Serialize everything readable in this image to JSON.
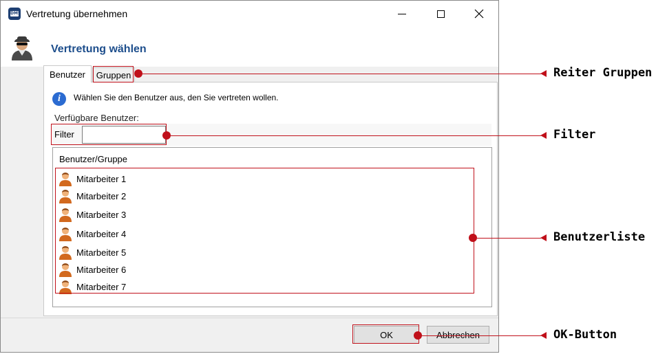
{
  "window": {
    "title": "Vertretung übernehmen",
    "app_icon_text": "DMS",
    "heading": "Vertretung wählen"
  },
  "tabs": [
    {
      "label": "Benutzer",
      "active": true
    },
    {
      "label": "Gruppen",
      "active": false
    }
  ],
  "panel": {
    "info_text": "Wählen Sie den Benutzer aus, den Sie vertreten wollen.",
    "available_label": "Verfügbare Benutzer:",
    "filter_label": "Filter",
    "filter_value": "",
    "list_header": "Benutzer/Gruppe",
    "users": [
      "Mitarbeiter 1",
      "Mitarbeiter 2",
      "Mitarbeiter 3",
      "Mitarbeiter 4",
      "Mitarbeiter 5",
      "Mitarbeiter 6",
      "Mitarbeiter 7"
    ]
  },
  "buttons": {
    "ok": "OK",
    "cancel": "Abbrechen"
  },
  "callouts": {
    "tab_groups": "Reiter Gruppen",
    "filter": "Filter",
    "user_list": "Benutzerliste",
    "ok_button": "OK-Button"
  },
  "colors": {
    "highlight": "#c0101a",
    "heading": "#1d4e8c",
    "info_icon": "#2b6bd1"
  }
}
